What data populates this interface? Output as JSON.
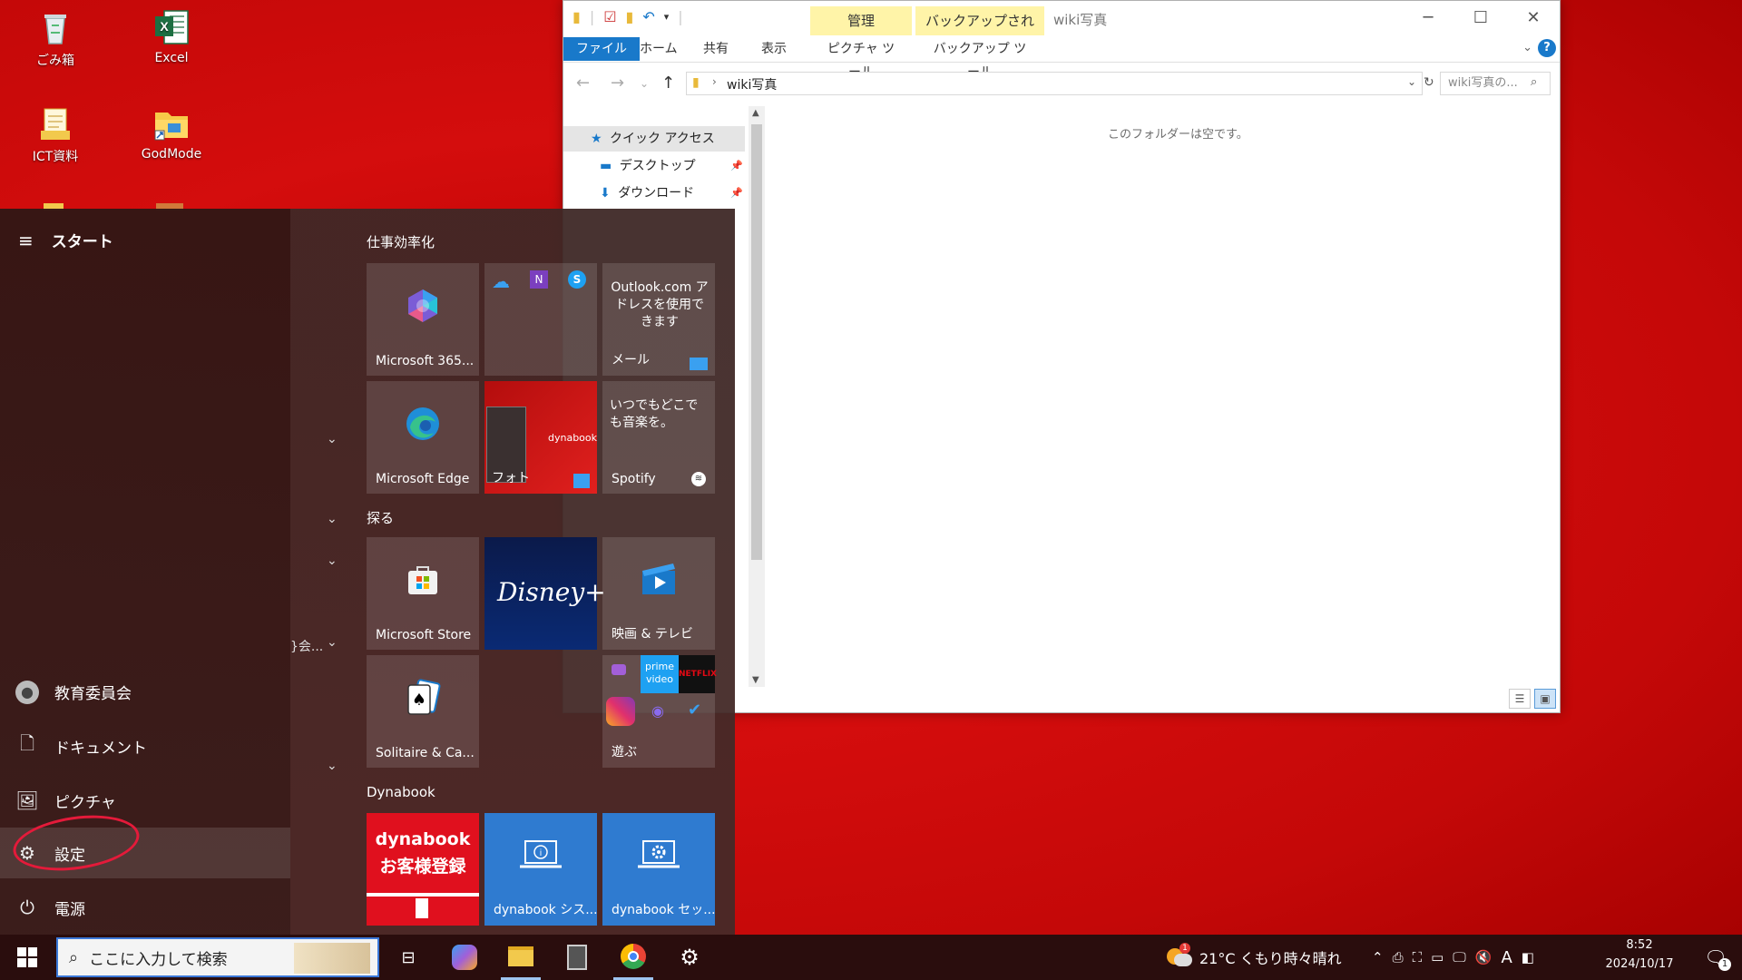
{
  "desktop": {
    "icons": [
      {
        "label": "ごみ箱",
        "icon": "recycle-bin-icon"
      },
      {
        "label": "Excel",
        "icon": "excel-icon"
      },
      {
        "label": "ICT資料",
        "icon": "folder-icon"
      },
      {
        "label": "GodMode",
        "icon": "folder-shortcut-icon"
      }
    ]
  },
  "explorer": {
    "title": "wiki写真",
    "context_tabs": [
      {
        "label": "管理"
      },
      {
        "label": "バックアップされません"
      }
    ],
    "ribbon_tabs": [
      "ファイル",
      "ホーム",
      "共有",
      "表示",
      "ピクチャ ツール",
      "バックアップ ツール"
    ],
    "address": {
      "path": "wiki写真"
    },
    "search_placeholder": "wiki写真の...",
    "nav": [
      {
        "label": "クイック アクセス",
        "icon": "star-icon"
      },
      {
        "label": "デスクトップ",
        "icon": "desktop-icon"
      },
      {
        "label": "ダウンロード",
        "icon": "download-icon"
      }
    ],
    "empty_message": "このフォルダーは空です。"
  },
  "start_menu": {
    "title": "スタート",
    "partial_label": "}会...",
    "left_items": [
      {
        "label": "教育委員会",
        "icon": "user-icon"
      },
      {
        "label": "ドキュメント",
        "icon": "document-icon"
      },
      {
        "label": "ピクチャ",
        "icon": "pictures-icon"
      },
      {
        "label": "設定",
        "icon": "gear-icon"
      },
      {
        "label": "電源",
        "icon": "power-icon"
      }
    ],
    "groups": [
      "仕事効率化",
      "探る",
      "Dynabook"
    ],
    "tiles": {
      "m365": "Microsoft 365...",
      "mail_text": "Outlook.com アドレスを使用できます",
      "mail_label": "メール",
      "edge": "Microsoft Edge",
      "photos": "フォト",
      "photos_brand": "dynabook",
      "spotify_text": "いつでもどこでも音楽を。",
      "spotify": "Spotify",
      "store": "Microsoft Store",
      "disney": "Disney+",
      "movies": "映画 & テレビ",
      "solitaire": "Solitaire & Ca...",
      "play": "遊ぶ",
      "prime": "prime video",
      "netflix": "NETFLIX",
      "dyn_reg_line1": "dynabook",
      "dyn_reg_line2": "お客様登録",
      "dyn_sys": "dynabook シス...",
      "dyn_set": "dynabook セッ..."
    }
  },
  "taskbar": {
    "search_placeholder": "ここに入力して検索",
    "weather": "21°C くもり時々晴れ",
    "ime": "A",
    "time": "8:52",
    "date": "2024/10/17",
    "weather_badge": "1",
    "notification_count": "1"
  },
  "colors": {
    "accent": "#1979ca",
    "tile_blue": "#2f7bd0",
    "dynabook_red": "#e0101e",
    "annotation": "#e41a3a"
  }
}
